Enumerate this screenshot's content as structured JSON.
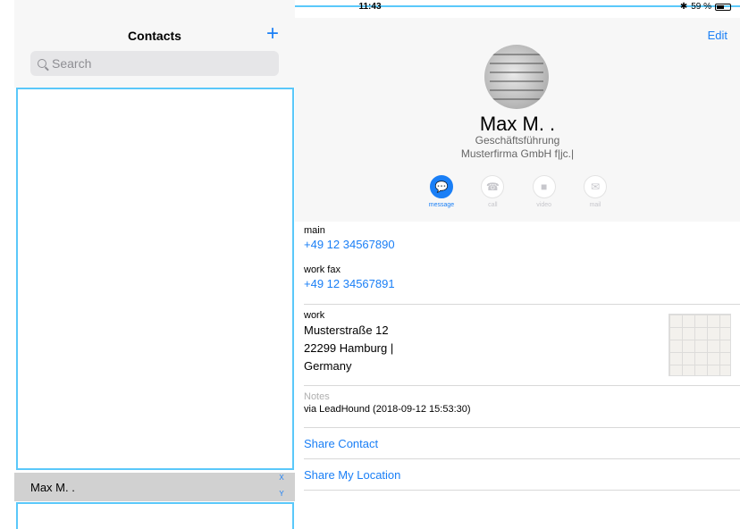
{
  "status": {
    "device": "iPad",
    "time": "11:43",
    "battery": "59 %",
    "bluetooth": "✱",
    "battery_level": 0.59
  },
  "left": {
    "title": "Contacts",
    "add_icon": "+",
    "search_placeholder": "Search",
    "contacts": [
      {
        "name": "Max M. ."
      }
    ],
    "index": [
      "X",
      "Y"
    ]
  },
  "detail": {
    "edit_label": "Edit",
    "name": "Max M. .",
    "subtitle_line1": "Geschäftsführung",
    "subtitle_line2": "Musterfirma GmbH f|jc.|",
    "actions": [
      {
        "label": "message",
        "icon": "message-icon"
      },
      {
        "label": "call",
        "icon": "phone-icon"
      },
      {
        "label": "video",
        "icon": "video-icon"
      },
      {
        "label": "mail",
        "icon": "mail-icon"
      }
    ],
    "main_label": "main",
    "main_value": "+49 12 34567890",
    "fax_label": "work fax",
    "fax_value": "+49 12 34567891",
    "address_label": "work",
    "address_line1": "Musterstraße 12",
    "address_line2": "22299 Hamburg |",
    "address_line3": "Germany",
    "notes_label": "Notes",
    "notes_value": "via LeadHound (2018-09-12 15:53:30)",
    "share_contact": "Share Contact",
    "share_location": "Share My Location"
  },
  "colors": {
    "accent": "#1a7ff6",
    "outline": "#5ac8fa"
  }
}
